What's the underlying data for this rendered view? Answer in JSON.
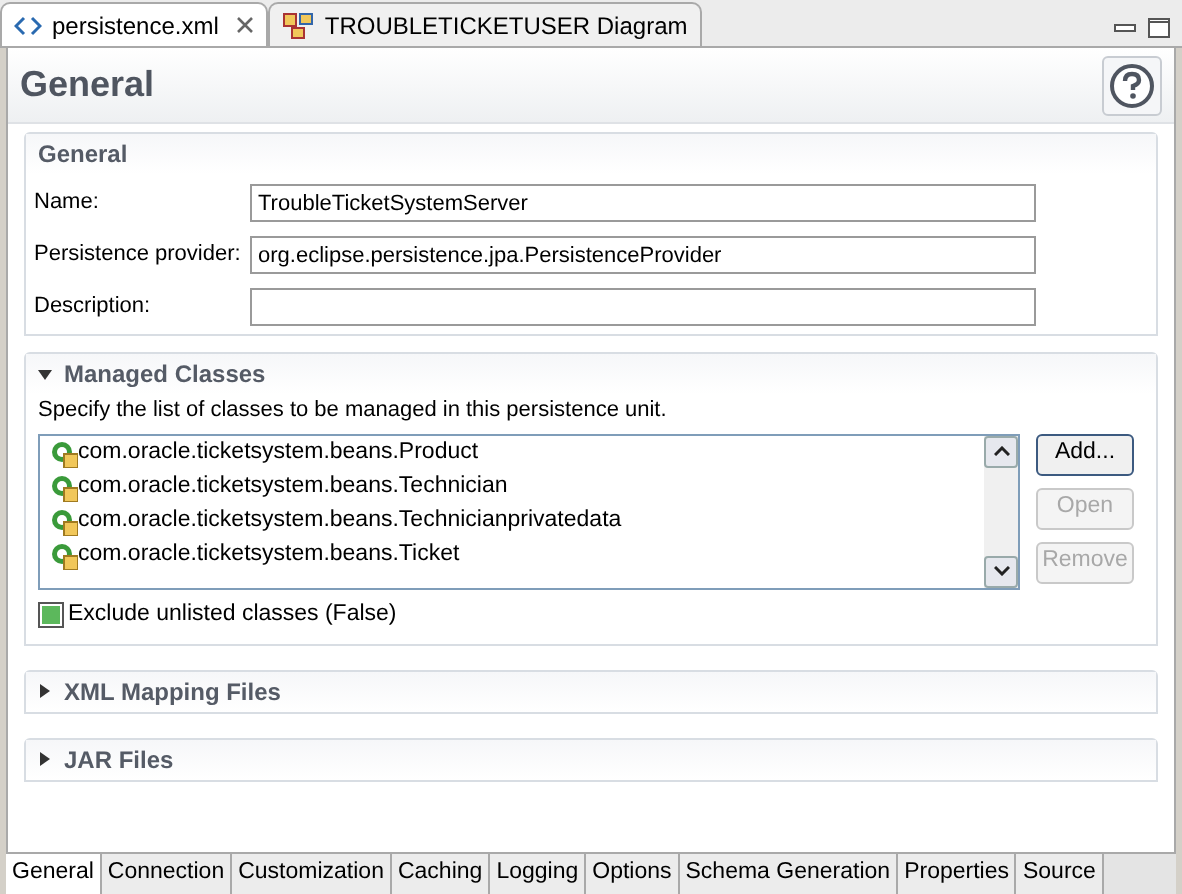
{
  "editor_tabs": [
    {
      "label": "persistence.xml",
      "kind": "xml",
      "selected": true,
      "closable": true
    },
    {
      "label": "TROUBLETICKETUSER Diagram",
      "kind": "diagram",
      "selected": false,
      "closable": false
    }
  ],
  "page_title": "General",
  "general_section": {
    "title": "General",
    "fields": [
      {
        "label": "Name:",
        "value": "TroubleTicketSystemServer"
      },
      {
        "label": "Persistence provider:",
        "value": "org.eclipse.persistence.jpa.PersistenceProvider"
      },
      {
        "label": "Description:"
      }
    ]
  },
  "managed_classes": {
    "title": "Managed Classes",
    "expanded": true,
    "description": "Specify the list of classes to be managed in this persistence unit.",
    "classes": [
      "com.oracle.ticketsystem.beans.Product",
      "com.oracle.ticketsystem.beans.Technician",
      "com.oracle.ticketsystem.beans.Technicianprivatedata",
      "com.oracle.ticketsystem.beans.Ticket"
    ],
    "buttons": [
      {
        "label": "Add...",
        "disabled": false
      },
      {
        "label": "Open",
        "disabled": true
      },
      {
        "label": "Remove",
        "disabled": true
      }
    ],
    "exclude_unlisted": {
      "label": "Exclude unlisted classes (False)",
      "default": true
    }
  },
  "collapsed_sections": [
    {
      "title": "XML Mapping Files",
      "expanded": false
    },
    {
      "title": "JAR Files",
      "expanded": false
    }
  ],
  "page_tabs": [
    {
      "label": "General",
      "selected": true
    },
    {
      "label": "Connection",
      "selected": false
    },
    {
      "label": "Customization",
      "selected": false
    },
    {
      "label": "Caching",
      "selected": false
    },
    {
      "label": "Logging",
      "selected": false
    },
    {
      "label": "Options",
      "selected": false
    },
    {
      "label": "Schema Generation",
      "selected": false
    },
    {
      "label": "Properties",
      "selected": false
    },
    {
      "label": "Source",
      "selected": false
    }
  ]
}
